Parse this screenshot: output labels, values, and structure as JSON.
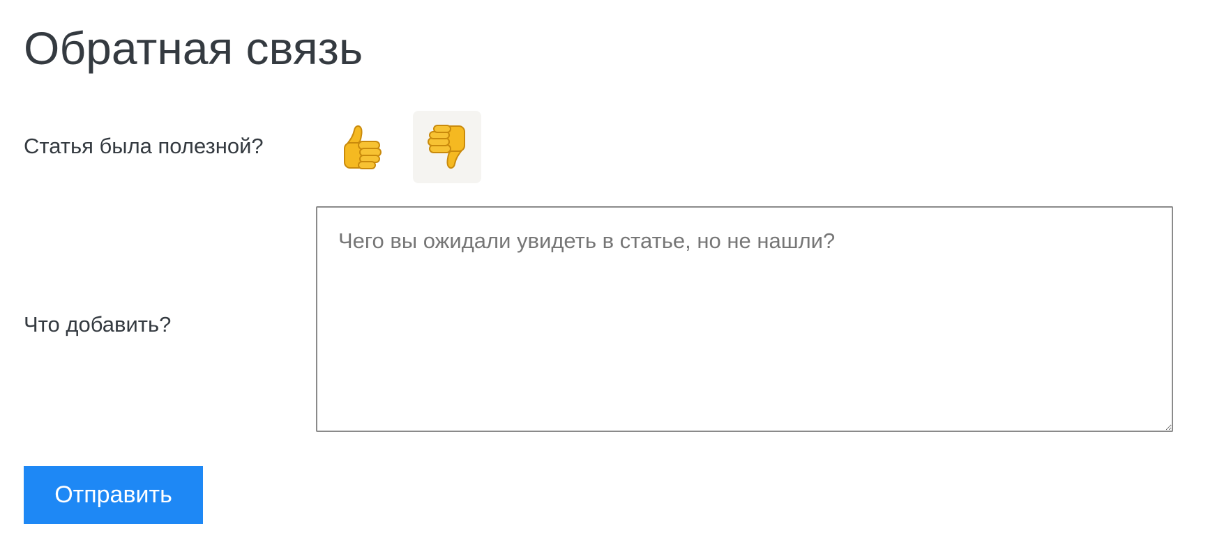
{
  "title": "Обратная связь",
  "helpful": {
    "question": "Статья была полезной?",
    "up_icon": "thumbs-up-icon",
    "down_icon": "thumbs-down-icon",
    "selected": "down"
  },
  "comment": {
    "label": "Что добавить?",
    "placeholder": "Чего вы ожидали увидеть в статье, но не нашли?",
    "value": ""
  },
  "submit_label": "Отправить",
  "colors": {
    "accent": "#1e88f5",
    "emoji": "#f5b921",
    "selected_bg": "#f5f4f1"
  }
}
